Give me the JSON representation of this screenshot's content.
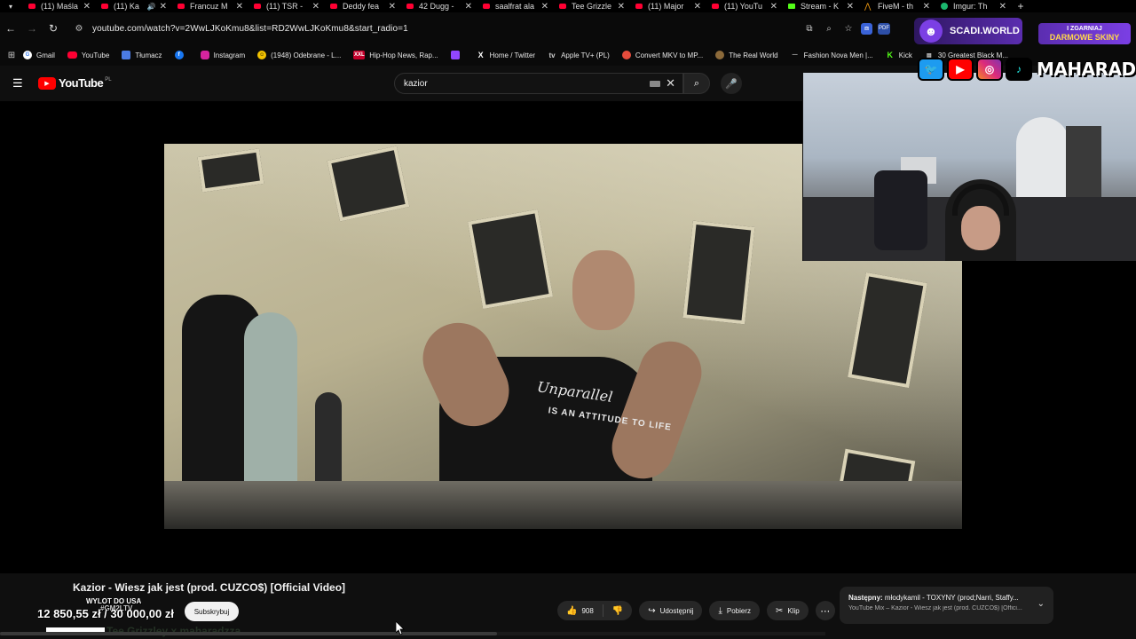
{
  "browser": {
    "tabs": [
      {
        "title": "(11) Maśla",
        "icon": "youtube-icon"
      },
      {
        "title": "(11) Ka",
        "icon": "youtube-icon",
        "audio": "🔊"
      },
      {
        "title": "Francuz M",
        "icon": "youtube-icon"
      },
      {
        "title": "(11) TSR -",
        "icon": "youtube-icon"
      },
      {
        "title": "Deddy fea",
        "icon": "youtube-icon"
      },
      {
        "title": "42 Dugg -",
        "icon": "youtube-icon"
      },
      {
        "title": "saalfrat ala",
        "icon": "youtube-icon"
      },
      {
        "title": "Tee Grizzle",
        "icon": "youtube-icon"
      },
      {
        "title": "(11) Major",
        "icon": "youtube-icon"
      },
      {
        "title": "(11) YouTu",
        "icon": "youtube-icon"
      },
      {
        "title": "Stream - K",
        "icon": "kick-icon"
      },
      {
        "title": "FiveM - th",
        "icon": "fivem-icon"
      },
      {
        "title": "Imgur: Th",
        "icon": "imgur-icon"
      }
    ],
    "url": "youtube.com/watch?v=2WwLJKoKmu8&list=RD2WwLJKoKmu8&start_radio=1",
    "bookmarks": [
      {
        "label": "Gmail",
        "icon": "google-icon",
        "glyph": "G"
      },
      {
        "label": "YouTube",
        "icon": "youtube-icon",
        "glyph": ""
      },
      {
        "label": "Tłumacz",
        "icon": "translate-icon",
        "glyph": ""
      },
      {
        "label": "",
        "icon": "facebook-icon",
        "glyph": "f"
      },
      {
        "label": "Instagram",
        "icon": "instagram-icon",
        "glyph": ""
      },
      {
        "label": "(1948) Odebrane - L...",
        "icon": "emoji-icon",
        "glyph": "☺"
      },
      {
        "label": "Hip-Hop News, Rap...",
        "icon": "hiphop-icon",
        "glyph": "XXL"
      },
      {
        "label": "",
        "icon": "twitch-icon",
        "glyph": ""
      },
      {
        "label": "Home / Twitter",
        "icon": "x-icon",
        "glyph": "X"
      },
      {
        "label": "Apple TV+ (PL)",
        "icon": "apple-icon",
        "glyph": "tv"
      },
      {
        "label": "Convert MKV to MP...",
        "icon": "convert-icon",
        "glyph": ""
      },
      {
        "label": "The Real World",
        "icon": "realworld-icon",
        "glyph": ""
      },
      {
        "label": "Fashion Nova Men |...",
        "icon": "fashion-icon",
        "glyph": "—"
      },
      {
        "label": "Kick",
        "icon": "kick-icon",
        "glyph": "K"
      },
      {
        "label": "30 Greatest Black M...",
        "icon": "film-icon",
        "glyph": "▤"
      }
    ]
  },
  "overlay": {
    "brand": "SCADI.WORLD",
    "promo_line1": "I ZGARNIAJ",
    "promo_line2": "DARMOWE SKINY",
    "handle": "MAHARADZZA"
  },
  "youtube": {
    "logo_text": "YouTube",
    "country": "PL",
    "search_query": "kazior",
    "video_title": "Kazior - Wiesz jak jest (prod. CUZCO$) [Official Video]",
    "subscribe_label": "Subskrybuj",
    "like_count": "908",
    "share_label": "Udostępnij",
    "download_label": "Pobierz",
    "clip_label": "Klip",
    "next_up_prefix": "Następny:",
    "next_up_title": "młodykamil - TOXYNY (prod;Narri, Staffy...",
    "next_up_sub": "YouTube Mix – Kazior - Wiesz jak jest (prod. CUZCO$) [Offici...",
    "shirt_line1": "Unparallel",
    "shirt_line2": "IS AN ATTITUDE TO LIFE"
  },
  "donation": {
    "goal_title": "WYLOT DO USA",
    "code": "#GM2LTV",
    "amount": "12 850,55 zł / 30 000,00 zł",
    "progress": 0.43,
    "ghost": "Tee Grizzley x maharadzza"
  }
}
